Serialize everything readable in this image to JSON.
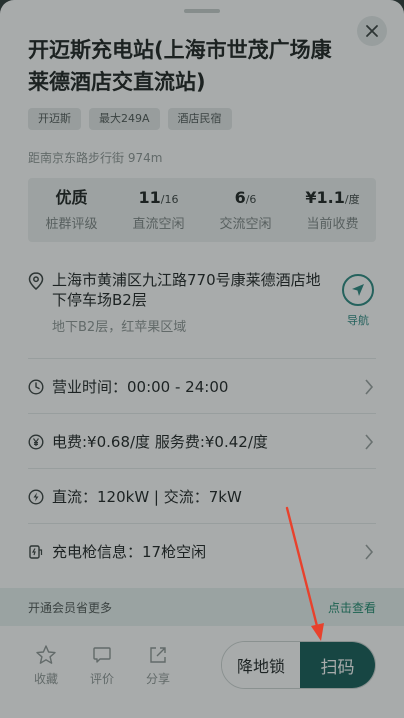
{
  "station": {
    "title": "开迈斯充电站(上海市世茂广场康莱德酒店交直流站)",
    "tags": [
      "开迈斯",
      "最大249A",
      "酒店民宿"
    ],
    "distance": "距南京东路步行街 974m"
  },
  "stats": [
    {
      "value": "优质",
      "suffix": "",
      "label": "桩群评级"
    },
    {
      "value": "11",
      "suffix": "/16",
      "label": "直流空闲"
    },
    {
      "value": "6",
      "suffix": "/6",
      "label": "交流空闲"
    },
    {
      "value": "¥1.1",
      "suffix": "/度",
      "label": "当前收费"
    }
  ],
  "address": {
    "line": "上海市黄浦区九江路770号康莱德酒店地下停车场B2层",
    "sub": "地下B2层，红苹果区域",
    "nav_label": "导航"
  },
  "rows": [
    {
      "icon": "clock-icon",
      "text": "营业时间：00:00 - 24:00",
      "chevron": true
    },
    {
      "icon": "yen-icon",
      "text": "电费:¥0.68/度   服务费:¥0.42/度",
      "chevron": true
    },
    {
      "icon": "lightning-icon",
      "text": "直流：120kW | 交流：7kW",
      "chevron": false
    },
    {
      "icon": "charger-icon",
      "text": "充电枪信息：17枪空闲",
      "chevron": true
    }
  ],
  "promo": {
    "text": "开通会员省更多",
    "link": "点击查看"
  },
  "actions": [
    {
      "icon": "star-icon",
      "label": "收藏"
    },
    {
      "icon": "comment-icon",
      "label": "评价"
    },
    {
      "icon": "share-icon",
      "label": "分享"
    }
  ],
  "buttons": {
    "lock": "降地锁",
    "scan": "扫码"
  },
  "colors": {
    "accent": "#155c58",
    "promo_link": "#1f8a6f",
    "annotation_arrow": "#e8412c"
  }
}
